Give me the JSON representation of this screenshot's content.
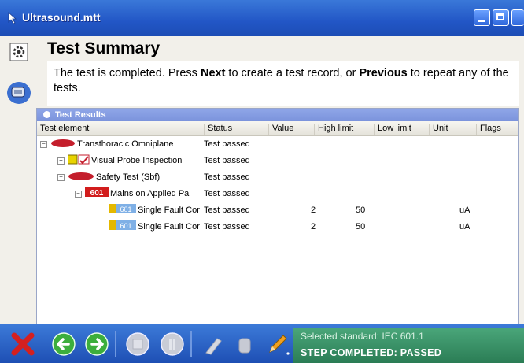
{
  "window": {
    "title": "Ultrasound.mtt"
  },
  "page": {
    "heading": "Test Summary",
    "instruction": {
      "part1": "The test is completed. Press ",
      "next": "Next",
      "part2": " to create a test record, or ",
      "previous": "Previous",
      "part3": " to repeat any of the tests."
    }
  },
  "results": {
    "panel_title": "Test Results",
    "columns": [
      "Test element",
      "Status",
      "Value",
      "High limit",
      "Low limit",
      "Unit",
      "Flags"
    ],
    "rows": [
      {
        "name": "Transthoracic Omniplane",
        "status": "Test passed",
        "value": "",
        "high": "",
        "unit": ""
      },
      {
        "name": "Visual Probe Inspection",
        "status": "Test passed",
        "value": "",
        "high": "",
        "unit": ""
      },
      {
        "name": "Safety Test (Sbf)",
        "status": "Test passed",
        "value": "",
        "high": "",
        "unit": ""
      },
      {
        "name": "Mains on Applied Pa",
        "badge": "601",
        "status": "Test passed",
        "value": "",
        "high": "",
        "unit": ""
      },
      {
        "name": "Single Fault Cor",
        "badge": "601",
        "status": "Test passed",
        "value": "2",
        "high": "50",
        "unit": "uA"
      },
      {
        "name": "Single Fault Cor",
        "badge": "601",
        "status": "Test passed",
        "value": "2",
        "high": "50",
        "unit": "uA"
      }
    ]
  },
  "toolbar": {
    "selected_standard": "Selected standard: IEC 601.1",
    "step_status": "STEP COMPLETED: PASSED"
  },
  "colors": {
    "titlebar": "#2256c6",
    "status_panel": "#2b7d55",
    "panel_header": "#8fa6e8"
  }
}
